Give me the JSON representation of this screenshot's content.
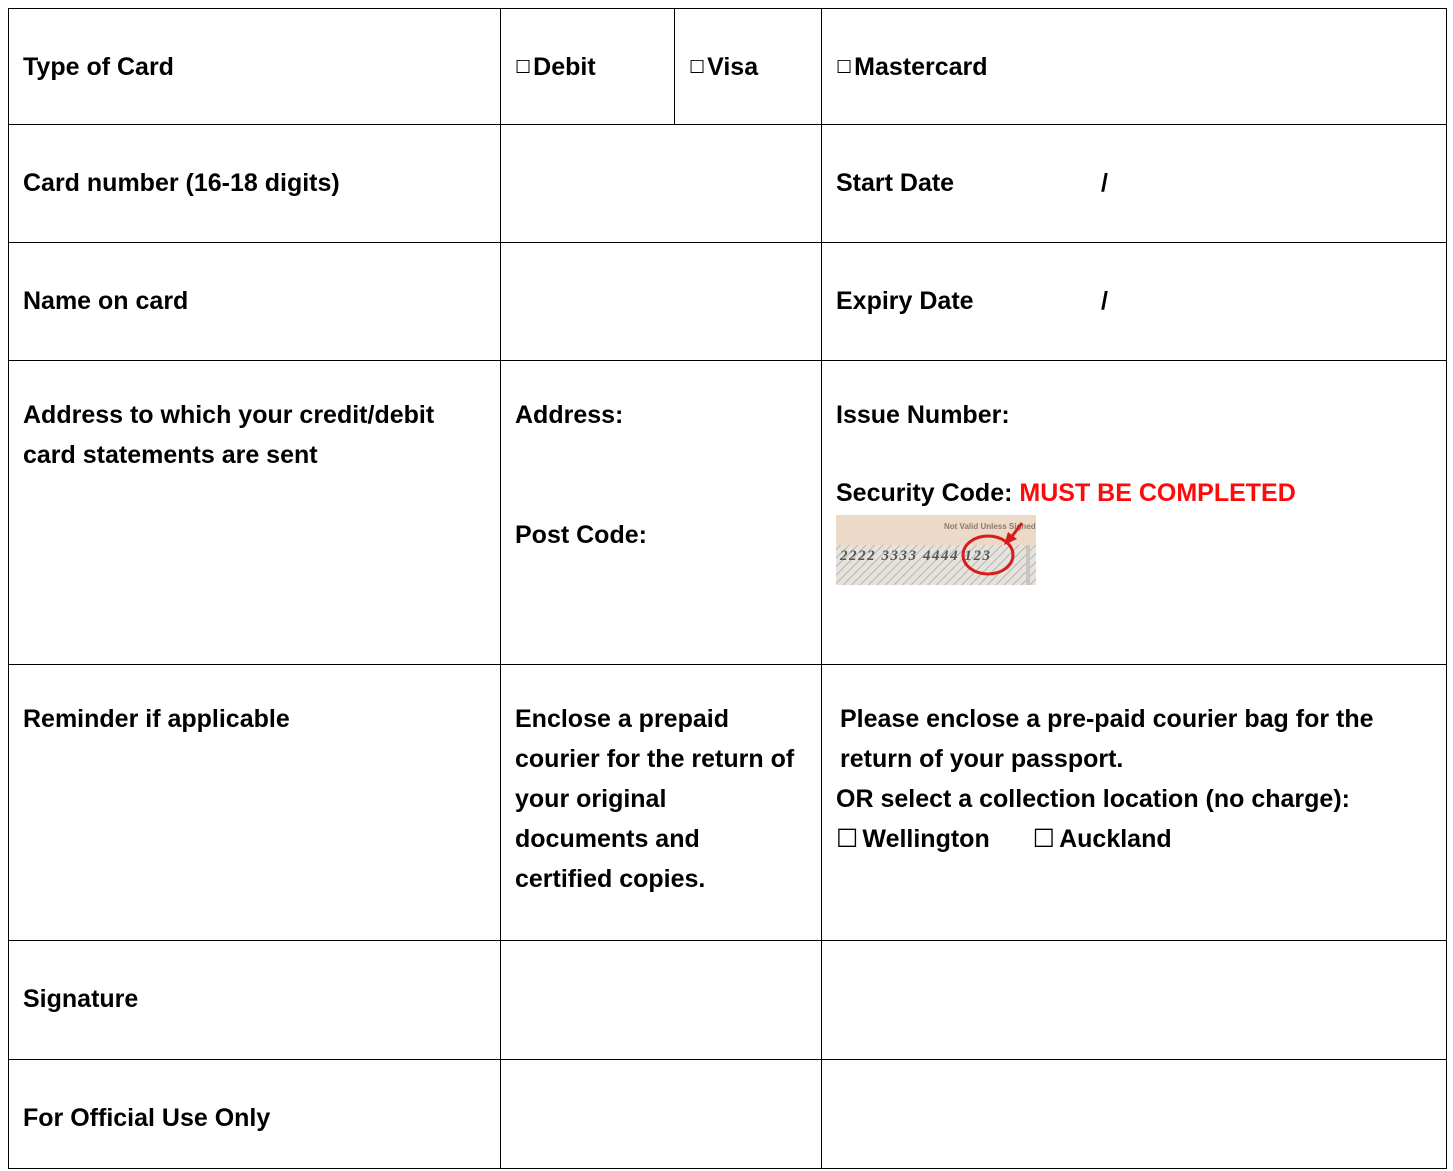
{
  "rows": {
    "type_of_card": {
      "label": "Type of Card",
      "options": [
        {
          "mark": "☐",
          "label": "Debit"
        },
        {
          "mark": "☐",
          "label": "Visa"
        },
        {
          "mark": "☐",
          "label": "Mastercard"
        }
      ]
    },
    "card_number": {
      "label": "Card number (16-18 digits)",
      "start_date_label": "Start Date",
      "date_separator": "/"
    },
    "name_on_card": {
      "label": "Name on card",
      "expiry_date_label": "Expiry Date",
      "date_separator": "/"
    },
    "address": {
      "label": "Address to which your credit/debit card statements are sent",
      "address_label": "Address:",
      "post_code_label": "Post Code:",
      "issue_number_label": "Issue Number:",
      "security_code_label": "Security Code:",
      "security_code_warning": "MUST BE COMPLETED",
      "card_image": {
        "caption": "Not Valid Unless Signed",
        "digits": "2222 3333 4444 123",
        "circled_code": "123"
      }
    },
    "reminder": {
      "label": "Reminder if applicable",
      "middle_text": "Enclose a prepaid courier for the return of your original documents and certified copies.",
      "right_line_1": "Please enclose a pre-paid courier bag for the return of your passport.",
      "right_line_2": "OR select a collection location (no charge):",
      "locations": [
        {
          "mark": "☐",
          "label": "Wellington"
        },
        {
          "mark": "☐",
          "label": "Auckland"
        }
      ]
    },
    "signature": {
      "label": "Signature"
    },
    "official_use": {
      "label": "For Official Use Only"
    }
  },
  "colors": {
    "warning": "#ff0a0a",
    "border": "#000000"
  }
}
